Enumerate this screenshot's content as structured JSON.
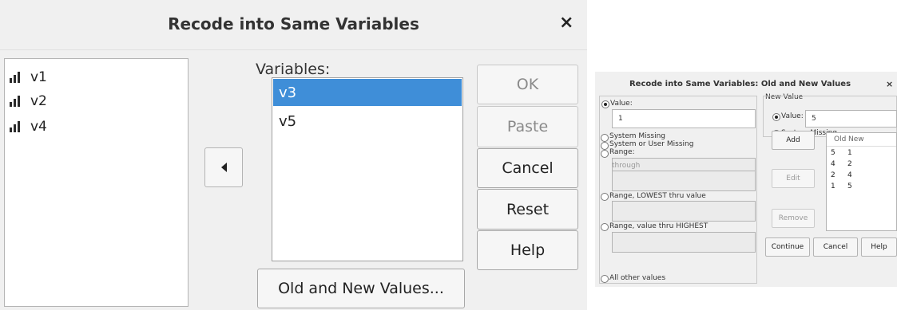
{
  "main_dialog": {
    "title": "Recode into Same Variables",
    "close_label": "×",
    "source_variables": [
      "v1",
      "v2",
      "v4"
    ],
    "variables_label": "Variables:",
    "variables": [
      "v3",
      "v5"
    ],
    "selected_variable": "v3",
    "buttons": {
      "ok": "OK",
      "paste": "Paste",
      "cancel": "Cancel",
      "reset": "Reset",
      "help": "Help",
      "old_new": "Old and New Values..."
    }
  },
  "values_dialog": {
    "title": "Recode into Same Variables: Old and New Values",
    "close_label": "×",
    "old_value": {
      "value_label": "Value:",
      "value_input": "1",
      "system_missing": "System Missing",
      "system_or_user_missing": "System or User Missing",
      "range_label": "Range:",
      "through_label": "through",
      "range_lowest": "Range, LOWEST thru value",
      "range_highest": "Range, value thru HIGHEST",
      "all_other": "All other values"
    },
    "new_value": {
      "group_label": "New Value",
      "value_label": "Value:",
      "value_input": "5",
      "system_missing": "System Missing"
    },
    "buttons": {
      "add": "Add",
      "edit": "Edit",
      "remove": "Remove",
      "continue": "Continue",
      "cancel": "Cancel",
      "help": "Help"
    },
    "old_new_list": {
      "headers": [
        "Old",
        "New"
      ],
      "rows": [
        [
          "5",
          "1"
        ],
        [
          "4",
          "2"
        ],
        [
          "2",
          "4"
        ],
        [
          "1",
          "5"
        ]
      ]
    }
  }
}
